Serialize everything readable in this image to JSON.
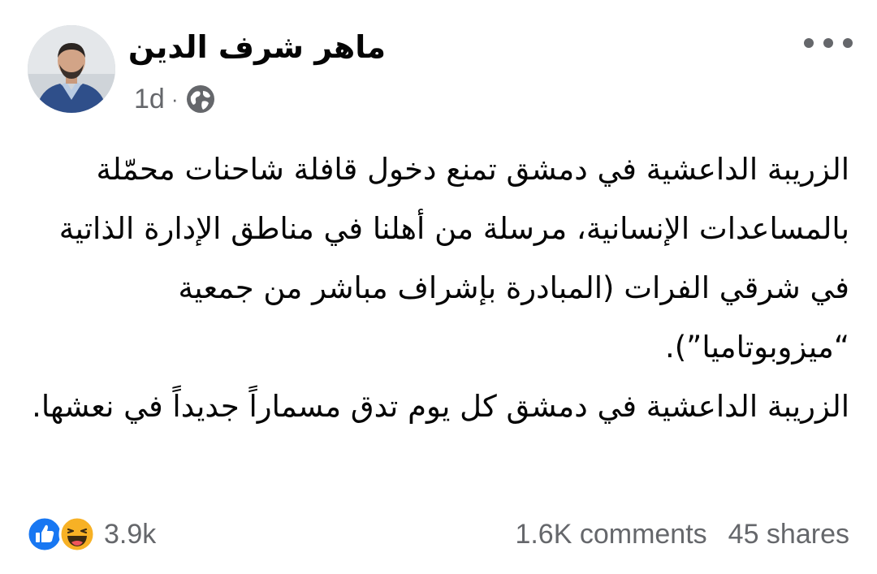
{
  "post": {
    "author": {
      "name": "ماهر شرف الدين"
    },
    "meta": {
      "time": "1d",
      "separator": "·",
      "privacy_icon": "globe-icon"
    },
    "more_icon": "more-horizontal-icon",
    "text": {
      "paragraph_1": "الزريبة الداعشية في دمشق تمنع دخول قافلة شاحنات محمّلة بالمساعدات الإنسانية، مرسلة من أهلنا في مناطق الإدارة الذاتية في شرقي الفرات (المبادرة بإشراف مباشر من جمعية “ميزوبوتاميا”).",
      "paragraph_2": "الزريبة الداعشية في دمشق كل يوم تدق مسماراً جديداً في نعشها."
    },
    "reactions": {
      "icons": [
        "like-icon",
        "haha-icon"
      ],
      "count": "3.9k"
    },
    "stats": {
      "comments": "1.6K comments",
      "shares": "45 shares"
    },
    "colors": {
      "like_blue": "#1877f2",
      "haha_yellow": "#f7b125",
      "secondary_text": "#65676b",
      "primary_text": "#050505"
    }
  }
}
